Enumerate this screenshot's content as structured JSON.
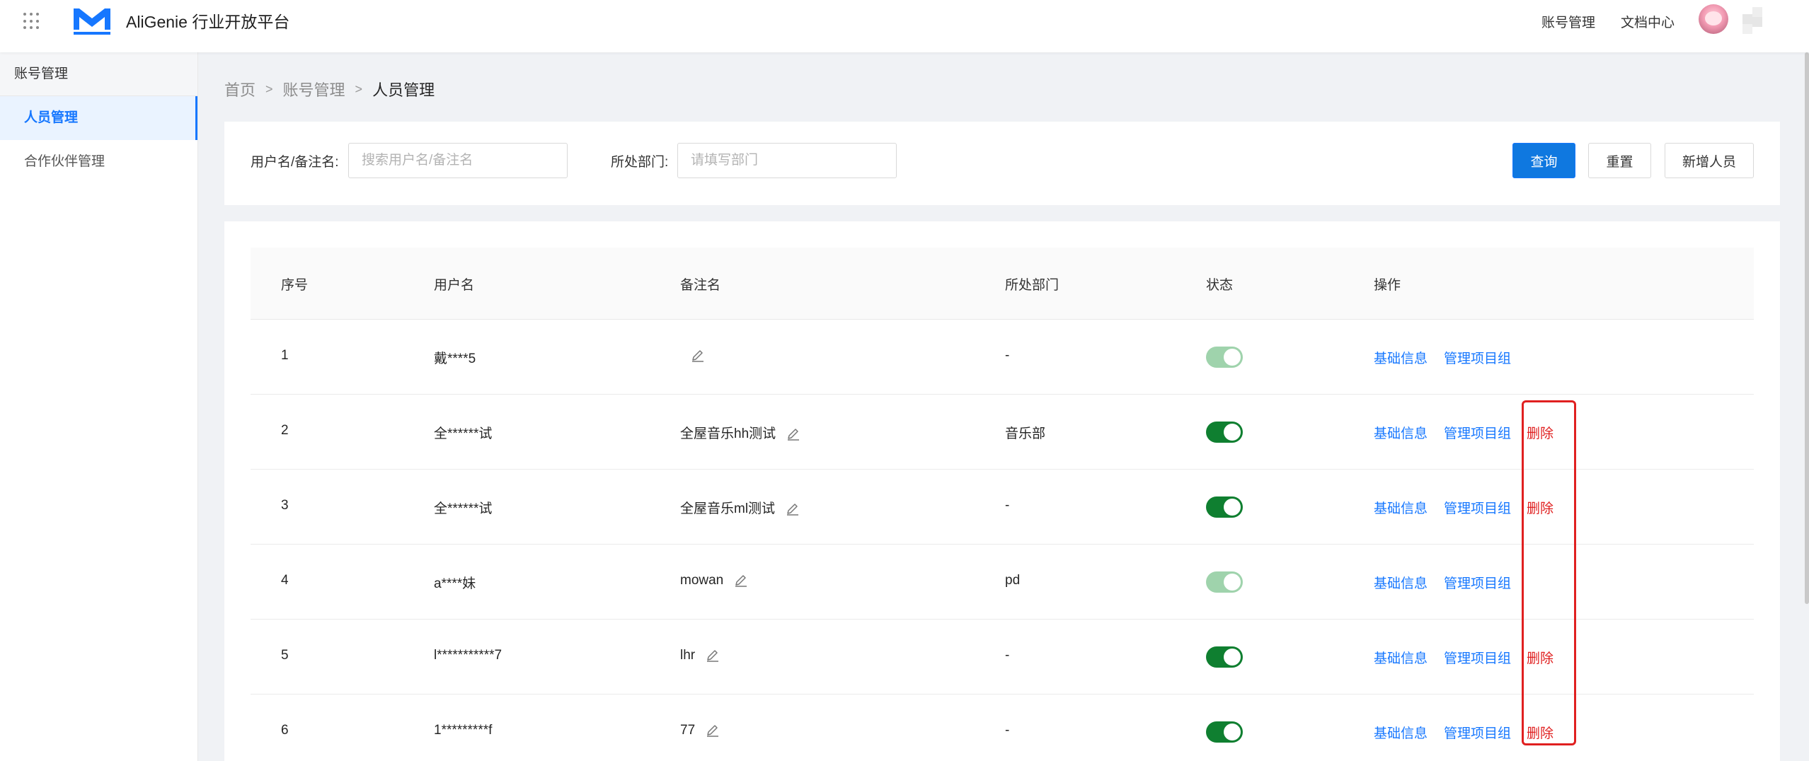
{
  "header": {
    "brand": "AliGenie 行业开放平台",
    "links": [
      "账号管理",
      "文档中心"
    ],
    "icons": {
      "apps": "apps-grid-icon",
      "logo": "aligenie-logo",
      "avatar": "user-avatar"
    },
    "colors": {
      "brand_blue": "#1677ff"
    }
  },
  "sidebar": {
    "group_title": "账号管理",
    "items": [
      {
        "label": "人员管理",
        "active": true
      },
      {
        "label": "合作伙伴管理",
        "active": false
      }
    ]
  },
  "breadcrumb": {
    "items": [
      "首页",
      "账号管理",
      "人员管理"
    ],
    "separator": ">"
  },
  "filters": {
    "username_label": "用户名/备注名:",
    "username_placeholder": "搜索用户名/备注名",
    "dept_label": "所处部门:",
    "dept_placeholder": "请填写部门",
    "query_label": "查询",
    "reset_label": "重置",
    "add_label": "新增人员"
  },
  "table": {
    "columns": [
      "序号",
      "用户名",
      "备注名",
      "所处部门",
      "状态",
      "操作"
    ],
    "rows": [
      {
        "index": "1",
        "username": "戴****5",
        "remark": "",
        "dept": "-",
        "status_on": true,
        "status_disabled": true,
        "ops": [
          "基础信息",
          "管理项目组"
        ],
        "delete": ""
      },
      {
        "index": "2",
        "username": "全******试",
        "remark": "全屋音乐hh测试",
        "dept": "音乐部",
        "status_on": true,
        "status_disabled": false,
        "ops": [
          "基础信息",
          "管理项目组"
        ],
        "delete": "删除"
      },
      {
        "index": "3",
        "username": "全******试",
        "remark": "全屋音乐ml测试",
        "dept": "-",
        "status_on": true,
        "status_disabled": false,
        "ops": [
          "基础信息",
          "管理项目组"
        ],
        "delete": "删除"
      },
      {
        "index": "4",
        "username": "a****妹",
        "remark": "mowan",
        "dept": "pd",
        "status_on": true,
        "status_disabled": true,
        "ops": [
          "基础信息",
          "管理项目组"
        ],
        "delete": ""
      },
      {
        "index": "5",
        "username": "l***********7",
        "remark": "lhr",
        "dept": "-",
        "status_on": true,
        "status_disabled": false,
        "ops": [
          "基础信息",
          "管理项目组"
        ],
        "delete": "删除"
      },
      {
        "index": "6",
        "username": "1*********f",
        "remark": "77",
        "dept": "-",
        "status_on": true,
        "status_disabled": false,
        "ops": [
          "基础信息",
          "管理项目组"
        ],
        "delete": "删除"
      }
    ],
    "colors": {
      "link": "#1677ff",
      "delete": "#e02020",
      "switch_on": "#0f7f30",
      "switch_disabled": "#9fd3ac"
    }
  }
}
